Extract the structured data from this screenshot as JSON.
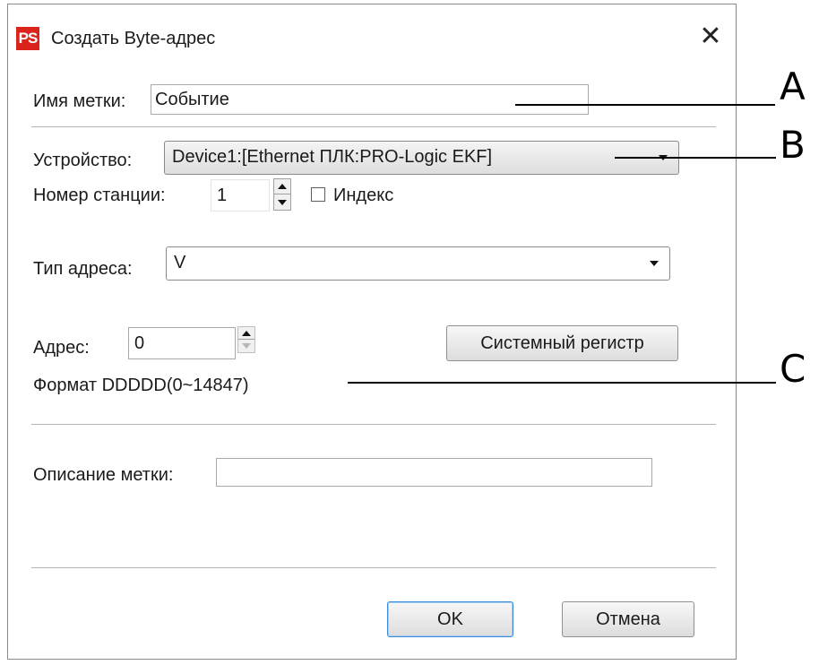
{
  "window": {
    "title": "Создать Byte-адрес",
    "app_icon_text": "PS",
    "close_symbol": "✕"
  },
  "form": {
    "tag_name_label": "Имя метки:",
    "tag_name_value": "Событие",
    "device_label": "Устройство:",
    "device_value": "Device1:[Ethernet ПЛК:PRO-Logic EKF]",
    "station_label": "Номер станции:",
    "station_value": "1",
    "index_label": "Индекс",
    "index_checked": false,
    "address_type_label": "Тип адреса:",
    "address_type_value": "V",
    "address_label": "Адрес:",
    "address_value": "0",
    "system_register_button": "Системный регистр",
    "format_text": "Формат DDDDD(0~14847)",
    "description_label": "Описание метки:",
    "description_value": ""
  },
  "buttons": {
    "ok": "OK",
    "cancel": "Отмена"
  },
  "callouts": {
    "a": "A",
    "b": "B",
    "c": "C"
  },
  "colors": {
    "app_icon": "#d9231b",
    "default_button_border": "#3c8ad8"
  }
}
